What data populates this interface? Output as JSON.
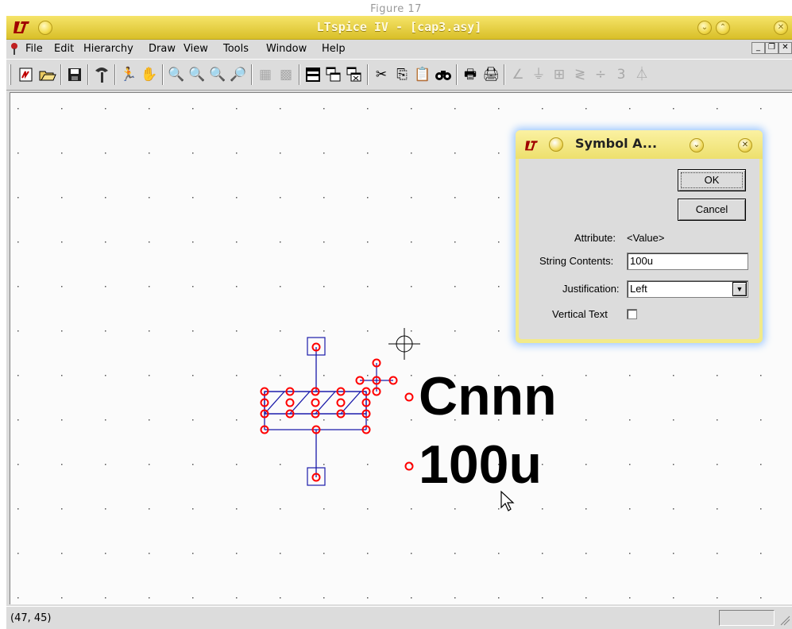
{
  "figure_caption": "Figure 17",
  "window": {
    "title": "LTspice IV - [cap3.asy]"
  },
  "menu": [
    "File",
    "Edit",
    "Hierarchy",
    "Draw",
    "View",
    "Tools",
    "Window",
    "Help"
  ],
  "toolbar": {
    "icons": [
      "new-schematic-icon",
      "open-icon",
      "save-icon",
      "control-panel-icon",
      "run-icon",
      "pan-icon",
      "zoom-in-icon",
      "zoom-area-icon",
      "zoom-out-icon",
      "zoom-fit-icon",
      "autoscale-icon",
      "tile-icon",
      "horizontal-tile-icon",
      "cascade-icon",
      "close-window-icon",
      "cut-icon",
      "copy-icon",
      "paste-icon",
      "find-icon",
      "print-setup-icon",
      "print-icon",
      "draw-wire-icon",
      "ground-icon",
      "label-net-icon",
      "resistor-icon",
      "capacitor-icon",
      "inductor-icon",
      "diode-icon"
    ]
  },
  "symbol": {
    "inst_name": "Cnnn",
    "value": "100u"
  },
  "status": {
    "coords": "(47, 45)"
  },
  "dialog": {
    "title": "Symbol A...",
    "ok_label": "OK",
    "cancel_label": "Cancel",
    "attribute_label": "Attribute:",
    "attribute_value": "<Value>",
    "string_contents_label": "String Contents:",
    "string_contents_value": "100u",
    "justification_label": "Justification:",
    "justification_value": "Left",
    "vertical_text_label": "Vertical Text",
    "vertical_text_checked": false
  },
  "colors": {
    "titlebar": "#e9d24a",
    "dialog_glow": "#9ec8ff",
    "symbol_line": "#1a1aaa",
    "handle": "#ff0000"
  }
}
